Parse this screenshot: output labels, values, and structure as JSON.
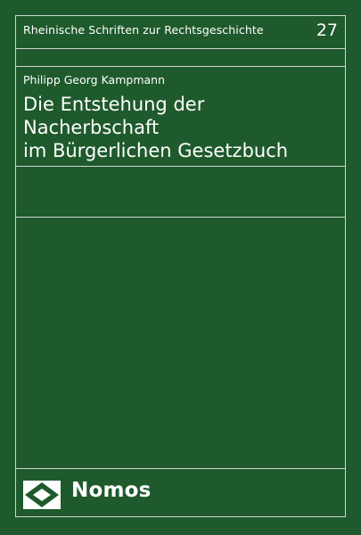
{
  "cover": {
    "series": "Rheinische Schriften zur Rechtsgeschichte",
    "volume": "27",
    "author": "Philipp Georg Kampmann",
    "title_lines": [
      "Die Entstehung der Nacherbschaft",
      "im Bürgerlichen Gesetzbuch"
    ],
    "publisher": "Nomos"
  },
  "colors": {
    "background": "#1f5a2c",
    "text": "#ffffff",
    "rule": "#cfd8cf"
  },
  "icons": {
    "logo": "nomos-diamond-logo-icon"
  }
}
